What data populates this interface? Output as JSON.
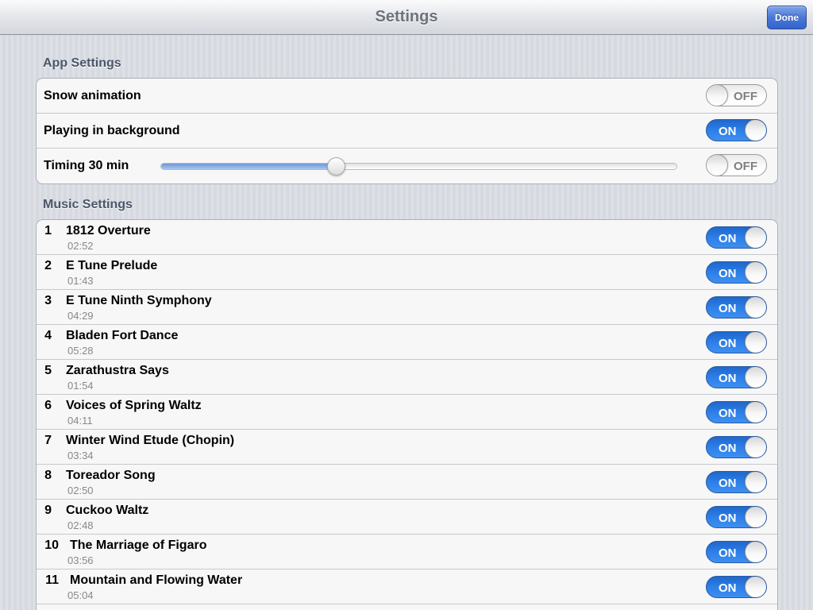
{
  "navbar": {
    "title": "Settings",
    "done_label": "Done"
  },
  "app_settings": {
    "header": "App Settings",
    "snow_animation": {
      "label": "Snow animation",
      "state": "OFF"
    },
    "playing_background": {
      "label": "Playing in background",
      "state": "ON"
    },
    "timing": {
      "label": "Timing 30 min",
      "slider_value": 0.34,
      "state": "OFF"
    }
  },
  "music_settings": {
    "header": "Music Settings",
    "tracks": [
      {
        "number": "1",
        "title": "1812 Overture",
        "duration": "02:52",
        "state": "ON"
      },
      {
        "number": "2",
        "title": "E Tune Prelude",
        "duration": "01:43",
        "state": "ON"
      },
      {
        "number": "3",
        "title": "E Tune Ninth Symphony",
        "duration": "04:29",
        "state": "ON"
      },
      {
        "number": "4",
        "title": "Bladen Fort Dance",
        "duration": "05:28",
        "state": "ON"
      },
      {
        "number": "5",
        "title": "Zarathustra Says",
        "duration": "01:54",
        "state": "ON"
      },
      {
        "number": "6",
        "title": "Voices of Spring Waltz",
        "duration": "04:11",
        "state": "ON"
      },
      {
        "number": "7",
        "title": "Winter Wind Etude (Chopin)",
        "duration": "03:34",
        "state": "ON"
      },
      {
        "number": "8",
        "title": "Toreador Song",
        "duration": "02:50",
        "state": "ON"
      },
      {
        "number": "9",
        "title": "Cuckoo Waltz",
        "duration": "02:48",
        "state": "ON"
      },
      {
        "number": "10",
        "title": "The Marriage of Figaro",
        "duration": "03:56",
        "state": "ON"
      },
      {
        "number": "11",
        "title": "Mountain and Flowing Water",
        "duration": "05:04",
        "state": "ON"
      }
    ]
  },
  "colors": {
    "switch_on": "#2d7fe8",
    "done_button": "#4b78d6"
  }
}
